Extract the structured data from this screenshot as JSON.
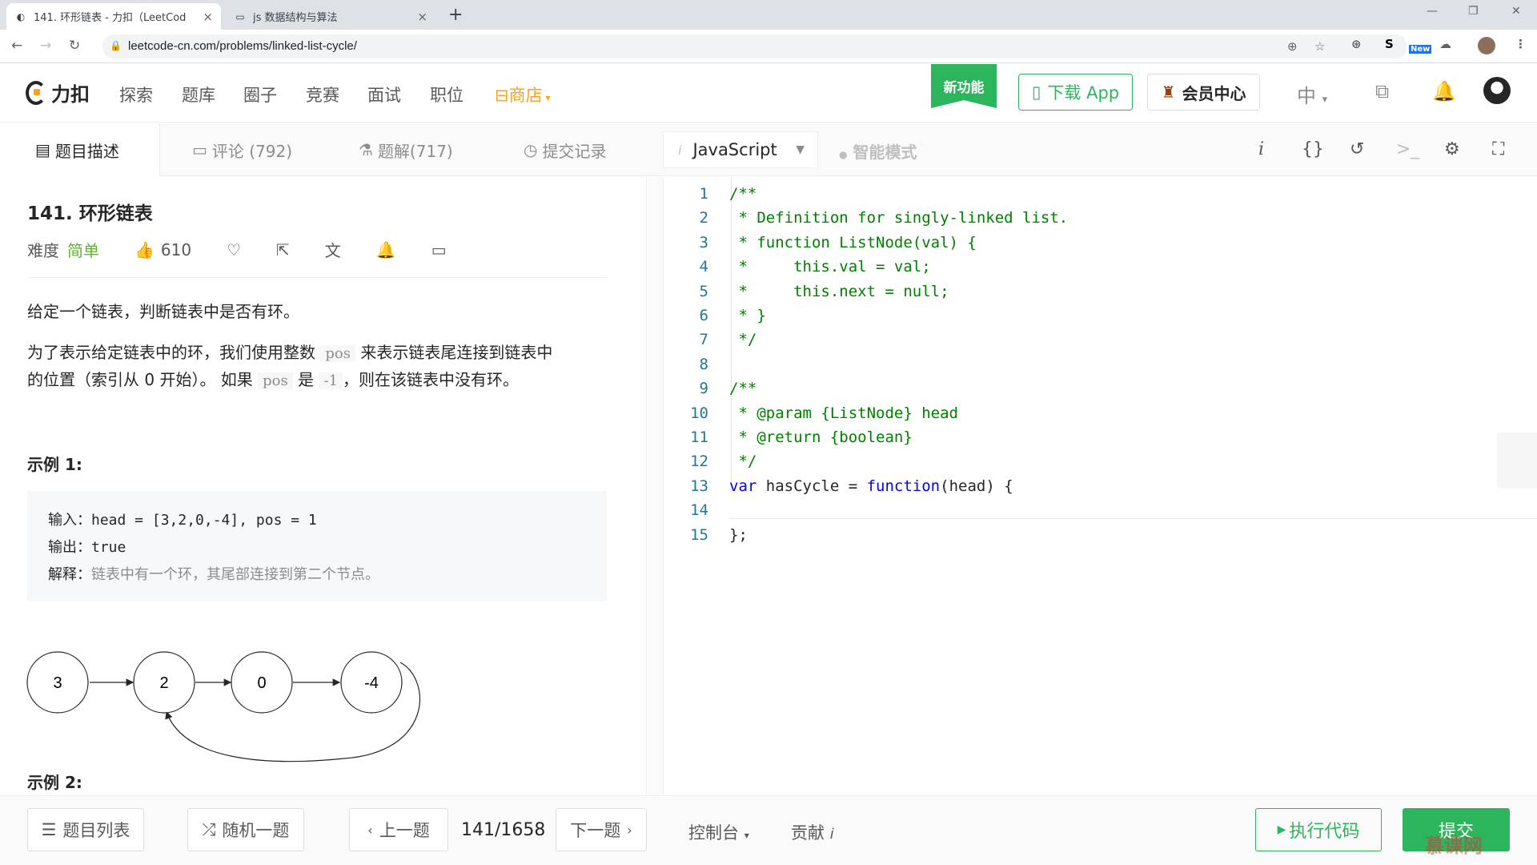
{
  "browser": {
    "tabs": [
      {
        "title": "141. 环形链表 - 力扣（LeetCod",
        "close": "×"
      },
      {
        "title": "js 数据结构与算法",
        "close": "×"
      }
    ],
    "new_tab": "+",
    "url": "leetcode-cn.com/problems/linked-list-cycle/",
    "ext_new_badge": "New",
    "ext_s": "S"
  },
  "header": {
    "logo_text": "力扣",
    "menu": [
      "探索",
      "题库",
      "圈子",
      "竞赛",
      "面试",
      "职位"
    ],
    "shop": "商店",
    "new_feature": "新功能",
    "download_app": "下载 App",
    "vip_center": "会员中心",
    "lang": "中"
  },
  "subnav": {
    "tabs": [
      {
        "label": "题目描述"
      },
      {
        "label": "评论 (792)"
      },
      {
        "label": "题解(717)"
      },
      {
        "label": "提交记录"
      }
    ],
    "language": "JavaScript",
    "smart_mode": "智能模式",
    "info_icon": "i"
  },
  "problem": {
    "title": "141. 环形链表",
    "difficulty_label": "难度",
    "difficulty": "简单",
    "likes": "610",
    "desc1": "给定一个链表，判断链表中是否有环。",
    "desc2_a": "为了表示给定链表中的环，我们使用整数",
    "desc2_pos": "pos",
    "desc2_b": "来表示链表尾连接到链表中",
    "desc2_c": "的位置（索引从 0 开始）。 如果",
    "desc2_pos2": "pos",
    "desc2_d": "是",
    "desc2_neg": "-1",
    "desc2_e": "，则在该链表中没有环。",
    "example1_title": "示例 1:",
    "example1": {
      "input_label": "输入：",
      "input": "head = [3,2,0,-4], pos = 1",
      "output_label": "输出：",
      "output": "true",
      "explain_label": "解释：",
      "explain": "链表中有一个环，其尾部连接到第二个节点。"
    },
    "diagram_nodes": [
      "3",
      "2",
      "0",
      "-4"
    ],
    "example2_title": "示例 2:"
  },
  "code_lines": [
    {
      "n": "1",
      "t": "/**"
    },
    {
      "n": "2",
      "t": " * Definition for singly-linked list."
    },
    {
      "n": "3",
      "t": " * function ListNode(val) {"
    },
    {
      "n": "4",
      "t": " *     this.val = val;"
    },
    {
      "n": "5",
      "t": " *     this.next = null;"
    },
    {
      "n": "6",
      "t": " * }"
    },
    {
      "n": "7",
      "t": " */"
    },
    {
      "n": "8",
      "t": ""
    },
    {
      "n": "9",
      "t": "/**"
    },
    {
      "n": "10",
      "t": " * @param {ListNode} head"
    },
    {
      "n": "11",
      "t": " * @return {boolean}"
    },
    {
      "n": "12",
      "t": " */"
    },
    {
      "n": "13",
      "t": "var hasCycle = function(head) {"
    },
    {
      "n": "14",
      "t": ""
    },
    {
      "n": "15",
      "t": "};"
    }
  ],
  "footer": {
    "problem_list": "题目列表",
    "random": "随机一题",
    "prev": "上一题",
    "page": "141/1658",
    "next": "下一题",
    "console": "控制台",
    "contribute": "贡献",
    "contribute_i": "i",
    "run": "执行代码",
    "submit": "提交",
    "watermark": "慕课网"
  }
}
